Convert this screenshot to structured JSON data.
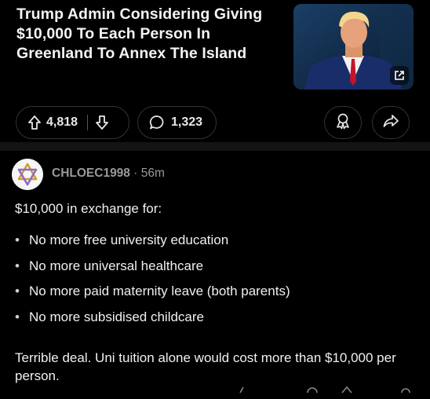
{
  "post": {
    "title": "Trump Admin Considering Giving $10,000 To Each Person In Greenland To Annex The Island"
  },
  "actions": {
    "score": "4,818",
    "comments": "1,323"
  },
  "comment": {
    "username": "CHLOEC1998",
    "separator": "·",
    "time": "56m",
    "intro": "$10,000 in exchange for:",
    "bullets": [
      "No more free university education",
      "No more universal healthcare",
      "No more paid maternity leave (both parents)",
      "No more subsidised childcare"
    ],
    "outro": "Terrible deal. Uni tuition alone would cost more than $10,000 per person."
  },
  "icons": {
    "upvote": "upvote-arrow-icon",
    "downvote": "downvote-arrow-icon",
    "comment": "speech-bubble-icon",
    "award": "award-ribbon-icon",
    "share": "share-arrow-icon",
    "external": "external-link-icon",
    "avatar": "star-of-david-avatar"
  },
  "colors": {
    "background": "#000000",
    "divider": "#141414",
    "muted_text": "#9a9a9a",
    "pill_border": "#333333"
  }
}
